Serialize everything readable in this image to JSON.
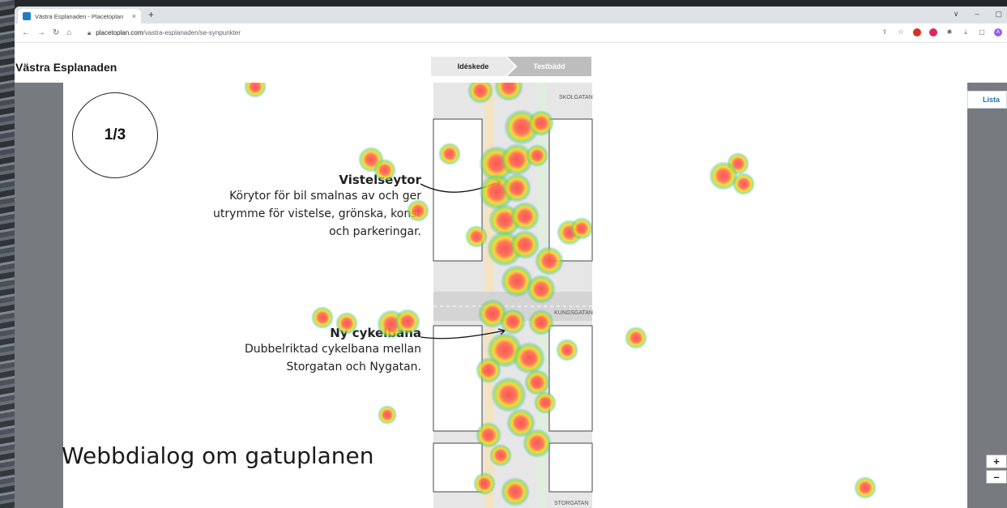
{
  "browser": {
    "tab_title": "Västra Esplanaden - Placetoplan",
    "tab_close": "×",
    "new_tab": "+",
    "url_domain": "placetoplan.com",
    "url_path": "/vastra-esplanaden/se-synpunkter",
    "window_controls": [
      "∨",
      "–",
      "▢"
    ],
    "extensions": [
      "share-icon",
      "star-icon",
      "opera-icon",
      "adblock-icon",
      "puzzle-icon",
      "download-icon",
      "sidebar-icon",
      "profile-avatar"
    ],
    "avatar_letter": "A"
  },
  "page": {
    "site_title": "Västra Esplanaden",
    "stages": [
      "Idéskede",
      "Testbädd"
    ],
    "active_stage": "Idéskede",
    "list_tab": "Lista",
    "zoom_in": "+",
    "zoom_out": "–"
  },
  "slide": {
    "step": "1/3",
    "annotations": [
      {
        "title": "Vistelseytor",
        "body": [
          "Körytor för bil smalnas av och ger",
          "utrymme för vistelse, grönska, konst",
          "och parkeringar."
        ]
      },
      {
        "title": "Ny cykelbana",
        "body": [
          "Dubbelriktad cykelbana mellan",
          "Storgatan och Nygatan."
        ]
      }
    ],
    "street_labels": [
      "SKOLGATAN",
      "KUNGSGATAN",
      "STORGATAN"
    ],
    "caption": "Webbdialog om gatuplanen"
  },
  "heatmap": {
    "colors": {
      "hot": "#ff4d4d",
      "warm": "#ffd21f",
      "mid": "#7fe03a",
      "cool": "#3a8dff"
    }
  }
}
